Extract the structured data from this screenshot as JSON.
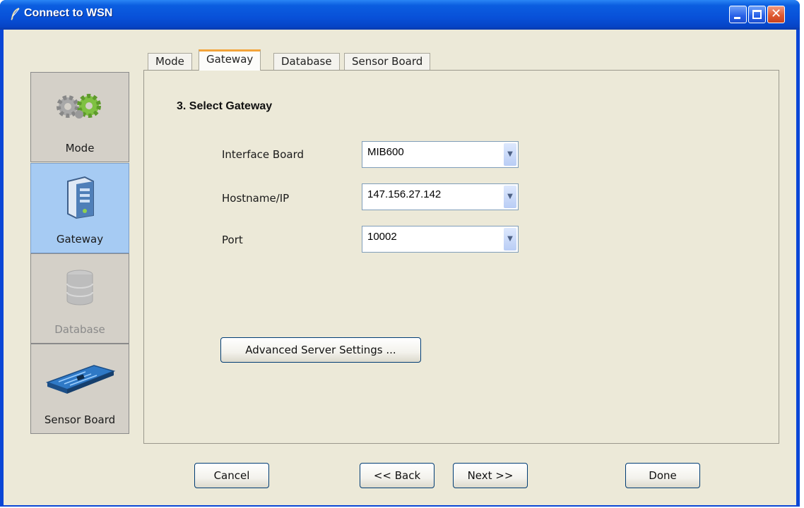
{
  "window": {
    "title": "Connect to WSN",
    "title_icon": "feather-icon"
  },
  "tabs": [
    "Mode",
    "Gateway",
    "Database",
    "Sensor Board"
  ],
  "selected_tab": "Gateway",
  "steps": [
    {
      "label": "Mode",
      "icon": "gears-icon",
      "state": "normal"
    },
    {
      "label": "Gateway",
      "icon": "server-icon",
      "state": "active"
    },
    {
      "label": "Database",
      "icon": "database-icon",
      "state": "disabled"
    },
    {
      "label": "Sensor Board",
      "icon": "circuit-board-icon",
      "state": "normal"
    }
  ],
  "panel": {
    "heading": "3. Select Gateway",
    "fields": [
      {
        "label": "Interface Board",
        "value": "MIB600"
      },
      {
        "label": "Hostname/IP",
        "value": "147.156.27.142"
      },
      {
        "label": "Port",
        "value": "10002"
      }
    ],
    "advanced_button": "Advanced Server Settings ..."
  },
  "footer": {
    "cancel": "Cancel",
    "back": "<< Back",
    "next": "Next >>",
    "done": "Done"
  }
}
